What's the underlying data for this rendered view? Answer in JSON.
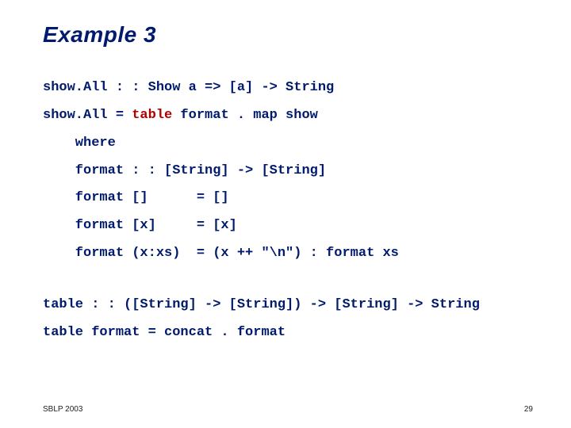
{
  "title": "Example 3",
  "code1": {
    "l1a": "show.All : : Show a => [a] -> String",
    "l2a": "show.All = ",
    "l2b": "table",
    "l2c": " format . map show",
    "l3": "    where",
    "l4": "    format : : [String] -> [String]",
    "l5": "    format []      = []",
    "l6": "    format [x]     = [x]",
    "l7": "    format (x:xs)  = (x ++ \"\\n\") : format xs"
  },
  "code2": {
    "l1": "table : : ([String] -> [String]) -> [String] -> String",
    "l2": "table format = concat . format"
  },
  "footer": {
    "left": "SBLP 2003",
    "right": "29"
  }
}
